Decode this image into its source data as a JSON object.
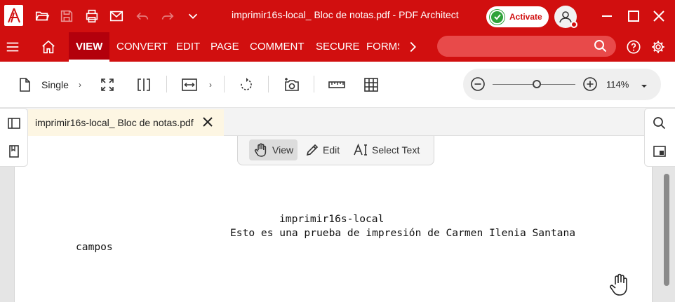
{
  "app": {
    "title": "imprimir16s-local_ Bloc de notas.pdf  -  PDF Architect",
    "activate_label": "Activate"
  },
  "ribbon": {
    "tabs": [
      "VIEW",
      "CONVERT",
      "EDIT",
      "PAGE",
      "COMMENT",
      "SECURE",
      "FORMS"
    ],
    "active_tab": "VIEW",
    "search_placeholder": ""
  },
  "toolbar": {
    "page_layout_label": "Single",
    "zoom_level": "114%",
    "zoom_slider_fraction": 0.53
  },
  "document_tab": {
    "name": "imprimir16s-local_ Bloc de notas.pdf"
  },
  "modes": {
    "view": "View",
    "edit": "Edit",
    "select_text": "Select Text",
    "active": "View"
  },
  "document": {
    "line1": "imprimir16s-local",
    "line2": "Esto es una prueba de impresión de Carmen Ilenia Santana",
    "line3": "campos"
  },
  "colors": {
    "brand_red": "#d10f0f",
    "activate_green": "#2fa33a"
  },
  "icons": [
    "logo-icon",
    "open-folder-icon",
    "save-icon",
    "print-icon",
    "email-icon",
    "undo-icon",
    "redo-icon",
    "chevron-down-icon",
    "user-icon",
    "minimize-icon",
    "maximize-icon",
    "close-icon",
    "menu-icon",
    "home-icon",
    "chevron-right-icon",
    "search-icon",
    "help-icon",
    "settings-icon",
    "page-icon",
    "fullscreen-icon",
    "split-view-icon",
    "fit-width-icon",
    "rotate-icon",
    "snapshot-icon",
    "ruler-icon",
    "grid-icon",
    "zoom-out-icon",
    "zoom-in-icon",
    "sidebar-icon",
    "bookmark-icon",
    "panel-icon",
    "hand-icon",
    "pencil-icon",
    "select-text-icon"
  ]
}
